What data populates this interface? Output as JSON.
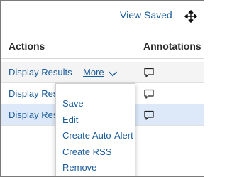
{
  "toolbar": {
    "view_saved_label": "View Saved",
    "move_icon": "move-arrows-icon"
  },
  "table": {
    "headers": {
      "actions": "Actions",
      "annotations": "Annotations"
    },
    "rows": [
      {
        "action_label": "Display Results",
        "more_label": "More",
        "annotation_icon": "comment-icon",
        "selected": false
      },
      {
        "action_label": "Display Resu",
        "annotation_icon": "comment-icon",
        "selected": false
      },
      {
        "action_label": "Display Resu",
        "annotation_icon": "comment-icon",
        "selected": true
      }
    ]
  },
  "more_menu": {
    "items": [
      "Save",
      "Edit",
      "Create Auto-Alert",
      "Create RSS",
      "Remove"
    ]
  },
  "colors": {
    "link": "#1a5c9c",
    "selected_row": "#dde9f8",
    "first_row": "#f4f4f4",
    "border": "#7a7a7a"
  }
}
